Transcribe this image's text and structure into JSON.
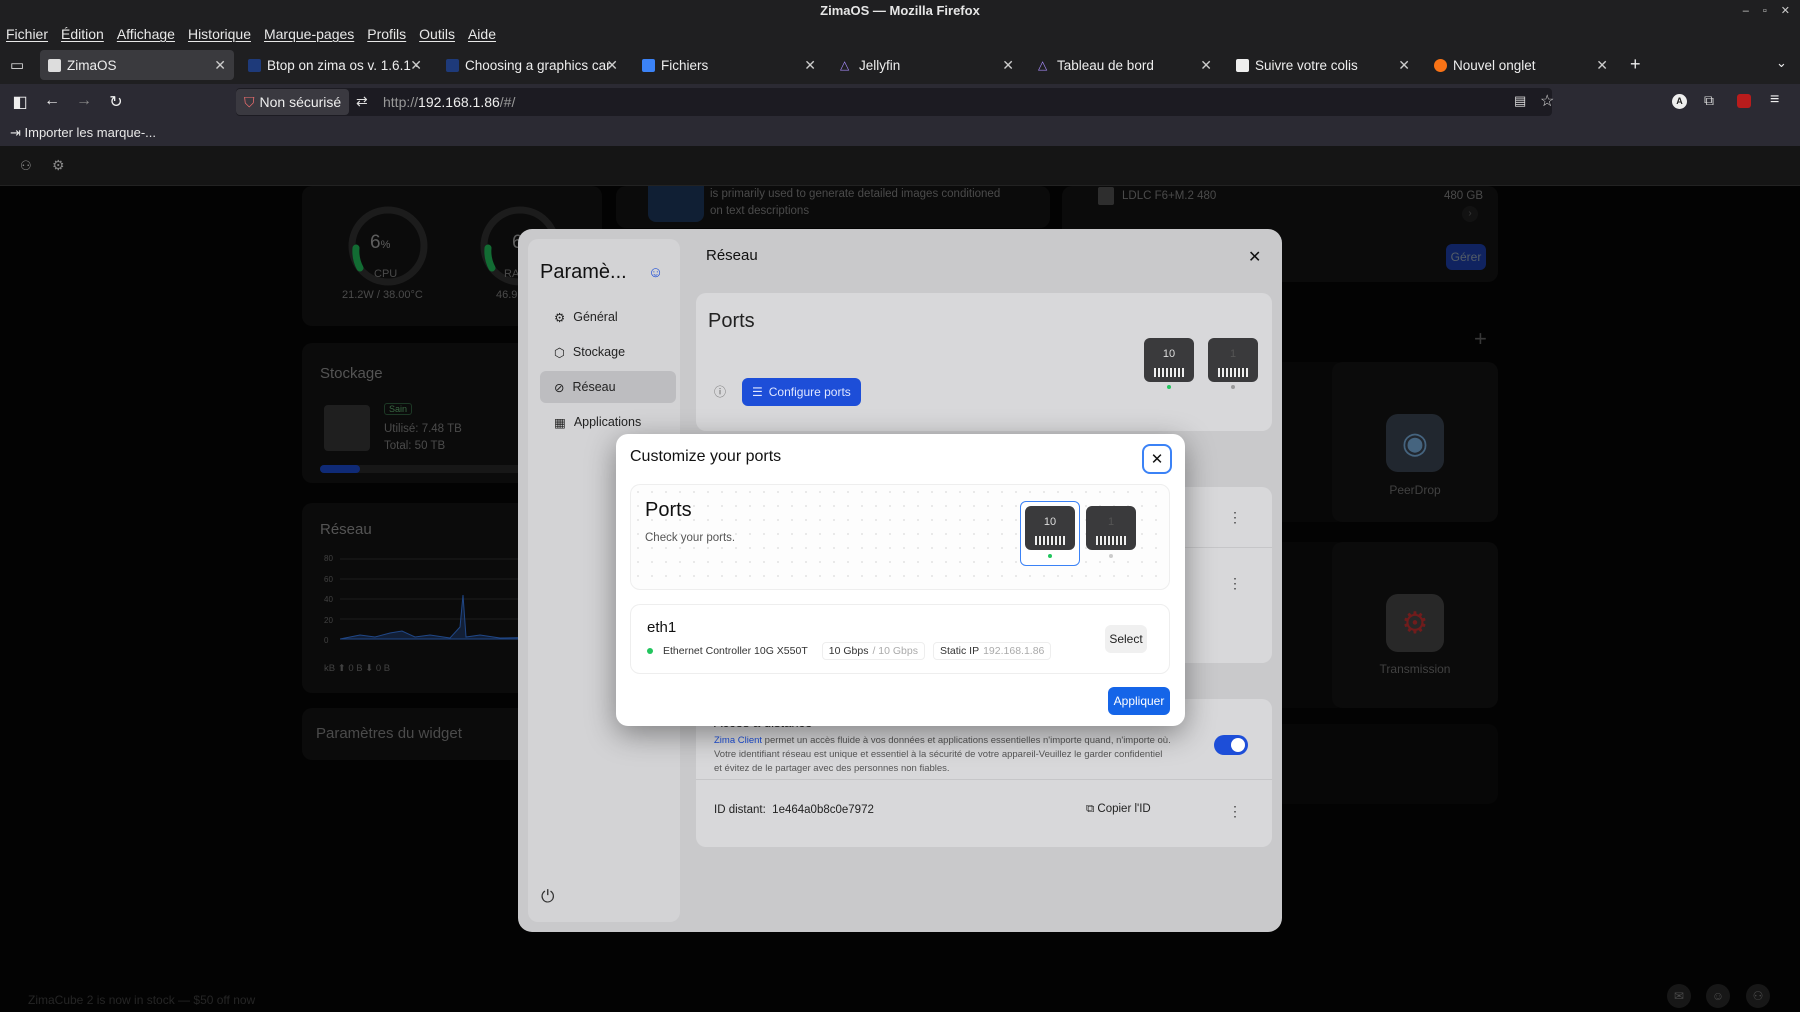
{
  "browser": {
    "window_title": "ZimaOS — Mozilla Firefox",
    "menu": [
      "Fichier",
      "Édition",
      "Affichage",
      "Historique",
      "Marque-pages",
      "Profils",
      "Outils",
      "Aide"
    ],
    "tabs": [
      {
        "label": "ZimaOS",
        "active": true
      },
      {
        "label": "Btop on zima os v. 1.6.1 ·"
      },
      {
        "label": "Choosing a graphics car"
      },
      {
        "label": "Fichiers"
      },
      {
        "label": "Jellyfin"
      },
      {
        "label": "Tableau de bord"
      },
      {
        "label": "Suivre votre colis"
      },
      {
        "label": "Nouvel onglet"
      }
    ],
    "security_label": "Non sécurisé",
    "url_prefix": "http://",
    "url_host": "192.168.1.86",
    "url_path": "/#/",
    "bookmark": "Importer les marque-..."
  },
  "dashboard": {
    "cpu": {
      "value": "6",
      "unit": "%",
      "label": "CPU",
      "detail": "21.2W / 38.00°C"
    },
    "ram": {
      "value": "6",
      "label": "RA",
      "detail": "46.9"
    },
    "app_desc_line1": "is primarily used to generate detailed images conditioned",
    "app_desc_line2": "on text descriptions",
    "disk": {
      "name": "LDLC F6+M.2 480",
      "size": "480 GB",
      "manage": "Gérer"
    },
    "storage": {
      "title": "Stockage",
      "badge": "Sain",
      "used": "Utilisé: 7.48 TB",
      "total": "Total: 50 TB",
      "used_fraction": 0.149
    },
    "network": {
      "title": "Réseau",
      "yticks": [
        "80",
        "60",
        "40",
        "20",
        "0"
      ],
      "footer": "kB ⬆ 0 B ⬇ 0 B"
    },
    "widget_settings": "Paramètres du widget",
    "apps": [
      {
        "name": "PeerDrop"
      },
      {
        "name": "Transmission"
      }
    ],
    "promo": "ZimaCube 2 is now in stock — $50 off now"
  },
  "settings": {
    "title": "Paramè...",
    "section_title": "Réseau",
    "nav": [
      "Général",
      "Stockage",
      "Réseau",
      "Applications"
    ],
    "ports_title": "Ports",
    "configure_ports": "Configure ports",
    "port_labels": [
      "10",
      "1"
    ],
    "remote_title": "Accès à distance",
    "remote_link": "Zima Client",
    "remote_text1": " permet un accès fluide à vos données et applications essentielles n'importe quand, n'importe où.",
    "remote_text2": "Votre identifiant réseau est unique et essentiel à la sécurité de votre appareil-Veuillez le garder confidentiel",
    "remote_text3": "et évitez de le partager avec des personnes non fiables.",
    "remote_id_label": "ID distant:",
    "remote_id": "1e464a0b8c0e7972",
    "copy_id": "Copier l'ID"
  },
  "modal": {
    "title": "Customize your ports",
    "ports_title": "Ports",
    "ports_sub": "Check your ports.",
    "port_labels": [
      "10",
      "1"
    ],
    "iface": "eth1",
    "controller": "Ethernet Controller 10G X550T",
    "speed": "10 Gbps",
    "speed_max": "/ 10 Gbps",
    "ip_label": "Static IP",
    "ip": "192.168.1.86",
    "select": "Select",
    "apply": "Appliquer"
  },
  "colors": {
    "accent": "#1565e8",
    "status_green": "#22c55e"
  }
}
